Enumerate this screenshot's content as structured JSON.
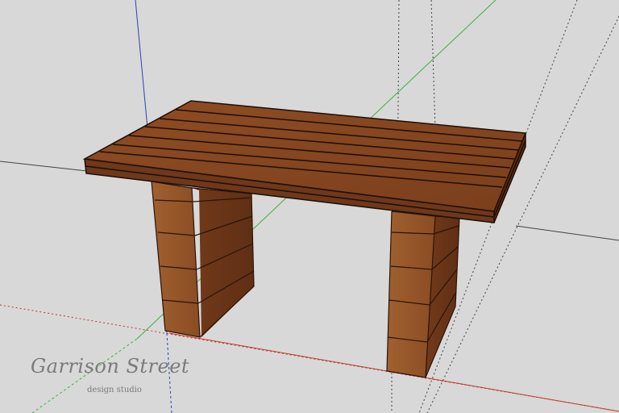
{
  "app": {
    "type": "3d-modeling-viewport"
  },
  "scene": {
    "object": "wooden-bench",
    "colors": {
      "background": "#d8d8d8",
      "wood_top": "#8a4a22",
      "wood_front": "#7a3f1c",
      "wood_leg_light": "#9a5a2e",
      "wood_leg_dark": "#6e381a",
      "axis_red": "#c0392b",
      "axis_green": "#3fae3f",
      "axis_blue": "#2e3fb5",
      "guide": "#555555"
    }
  },
  "watermark": {
    "brand": "Garrison Street",
    "subtitle": "design studio"
  }
}
